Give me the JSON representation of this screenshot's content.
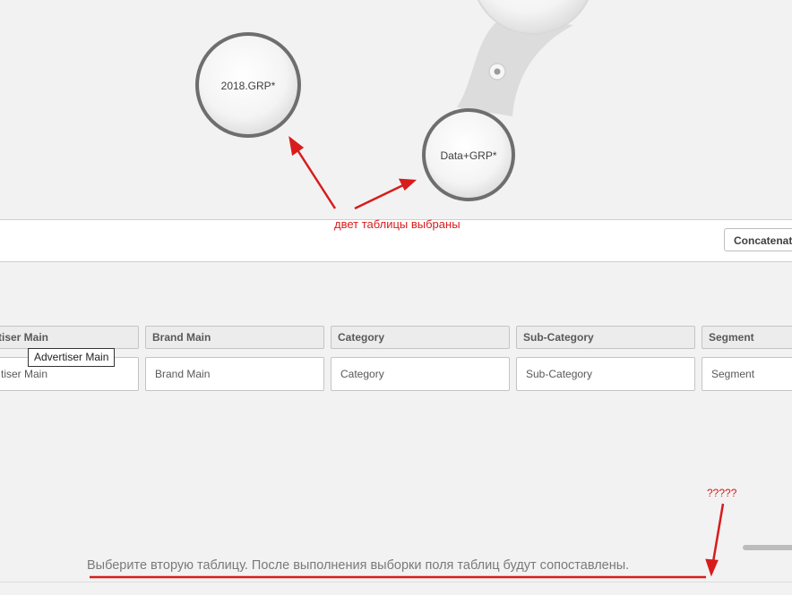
{
  "diagram": {
    "node_left_label": "2018.GRP*",
    "node_right_label": "Data+GRP*"
  },
  "annotations": {
    "two_tables_selected": "двет таблицы выбраны",
    "question_marks": "?????",
    "accent_color": "#d81c1c"
  },
  "toolbar": {
    "concatenate_label": "Concatenat"
  },
  "fields": [
    {
      "header": "tiser Main",
      "placeholder": "tiser Main"
    },
    {
      "header": "Brand Main",
      "placeholder": "Brand Main"
    },
    {
      "header": "Category",
      "placeholder": "Category"
    },
    {
      "header": "Sub-Category",
      "placeholder": "Sub-Category"
    },
    {
      "header": "Segment",
      "placeholder": "Segment"
    }
  ],
  "tooltip": {
    "text": "Advertiser Main"
  },
  "hint": {
    "text": "Выберите вторую таблицу. После выполнения выборки поля таблиц будут сопоставлены."
  }
}
